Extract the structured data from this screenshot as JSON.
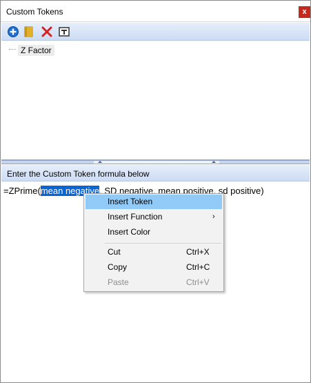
{
  "window": {
    "title": "Custom Tokens",
    "close_label": "x"
  },
  "toolbar": {
    "buttons": [
      {
        "icon": "add-icon",
        "color": "#1f6fd0"
      },
      {
        "icon": "folder-icon",
        "color": "#e2b12c"
      },
      {
        "icon": "delete-icon",
        "color": "#d62020"
      },
      {
        "icon": "rename-icon",
        "color": "#333333"
      }
    ]
  },
  "tree": {
    "items": [
      {
        "label": "Z Factor"
      }
    ]
  },
  "formula": {
    "header": "Enter the Custom Token formula below",
    "prefix": "=ZPrime(",
    "selected": "mean negative",
    "suffix": ", SD negative, mean positive, sd positive)",
    "selection_color": "#0a64d4"
  },
  "context_menu": {
    "items": [
      {
        "label": "Insert Token",
        "highlighted": true
      },
      {
        "label": "Insert Function",
        "submenu": true
      },
      {
        "label": "Insert Color"
      },
      {
        "label": "Cut",
        "shortcut": "Ctrl+X"
      },
      {
        "label": "Copy",
        "shortcut": "Ctrl+C"
      },
      {
        "label": "Paste",
        "shortcut": "Ctrl+V",
        "disabled": true
      }
    ],
    "highlight_color": "#91c9f7"
  }
}
